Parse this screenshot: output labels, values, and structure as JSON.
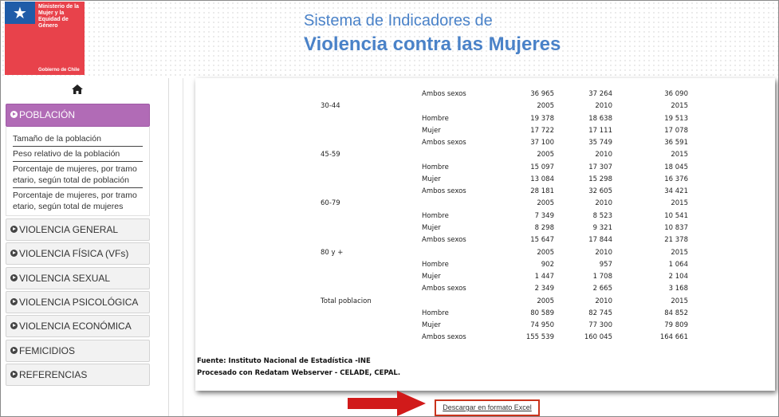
{
  "header": {
    "logo_text": "Ministerio de la Mujer y la Equidad de Género",
    "logo_footer": "Gobierno de Chile",
    "title_line1": "Sistema de Indicadores de",
    "title_line2": "Violencia contra las Mujeres"
  },
  "sidebar": {
    "home_icon": "home-icon",
    "active_section": "POBLACIÓN",
    "sub_items": [
      "Tamaño de la población",
      "Peso relativo de la población",
      "Porcentaje de mujeres, por tramo etario, según total de población",
      "Porcentaje de mujeres, por tramo etario, según total de mujeres"
    ],
    "sections": [
      "VIOLENCIA GENERAL",
      "VIOLENCIA FÍSICA (VFs)",
      "VIOLENCIA SEXUAL",
      "VIOLENCIA PSICOLÓGICA (VPsi)",
      "VIOLENCIA ECONÓMICA",
      "FEMICIDIOS",
      "REFERENCIAS"
    ],
    "active_color": "#b16bb6"
  },
  "table": {
    "top_row": {
      "label": "Ambos sexos",
      "values": [
        "36 965",
        "37 264",
        "36 090"
      ]
    },
    "groups": [
      {
        "name": "30-44",
        "years": [
          "2005",
          "2010",
          "2015"
        ],
        "rows": [
          {
            "label": "Hombre",
            "values": [
              "19 378",
              "18 638",
              "19 513"
            ]
          },
          {
            "label": "Mujer",
            "values": [
              "17 722",
              "17 111",
              "17 078"
            ]
          },
          {
            "label": "Ambos sexos",
            "values": [
              "37 100",
              "35 749",
              "36 591"
            ]
          }
        ]
      },
      {
        "name": "45-59",
        "years": [
          "2005",
          "2010",
          "2015"
        ],
        "rows": [
          {
            "label": "Hombre",
            "values": [
              "15 097",
              "17 307",
              "18 045"
            ]
          },
          {
            "label": "Mujer",
            "values": [
              "13 084",
              "15 298",
              "16 376"
            ]
          },
          {
            "label": "Ambos sexos",
            "values": [
              "28 181",
              "32 605",
              "34 421"
            ]
          }
        ]
      },
      {
        "name": "60-79",
        "years": [
          "2005",
          "2010",
          "2015"
        ],
        "rows": [
          {
            "label": "Hombre",
            "values": [
              "7 349",
              "8 523",
              "10 541"
            ]
          },
          {
            "label": "Mujer",
            "values": [
              "8 298",
              "9 321",
              "10 837"
            ]
          },
          {
            "label": "Ambos sexos",
            "values": [
              "15 647",
              "17 844",
              "21 378"
            ]
          }
        ]
      },
      {
        "name": "80 y +",
        "years": [
          "2005",
          "2010",
          "2015"
        ],
        "rows": [
          {
            "label": "Hombre",
            "values": [
              "902",
              "957",
              "1 064"
            ]
          },
          {
            "label": "Mujer",
            "values": [
              "1 447",
              "1 708",
              "2 104"
            ]
          },
          {
            "label": "Ambos sexos",
            "values": [
              "2 349",
              "2 665",
              "3 168"
            ]
          }
        ]
      },
      {
        "name": "Total poblacion",
        "years": [
          "2005",
          "2010",
          "2015"
        ],
        "rows": [
          {
            "label": "Hombre",
            "values": [
              "80 589",
              "82 745",
              "84 852"
            ]
          },
          {
            "label": "Mujer",
            "values": [
              "74 950",
              "77 300",
              "79 809"
            ]
          },
          {
            "label": "Ambos sexos",
            "values": [
              "155 539",
              "160 045",
              "164 661"
            ]
          }
        ]
      }
    ]
  },
  "footer": {
    "source": "Fuente: Instituto Nacional de Estadística -INE",
    "processed": "Procesado con Redatam Webserver - CELADE, CEPAL."
  },
  "download": {
    "label": "Descargar en formato Excel",
    "highlight_color": "#c9331c"
  }
}
